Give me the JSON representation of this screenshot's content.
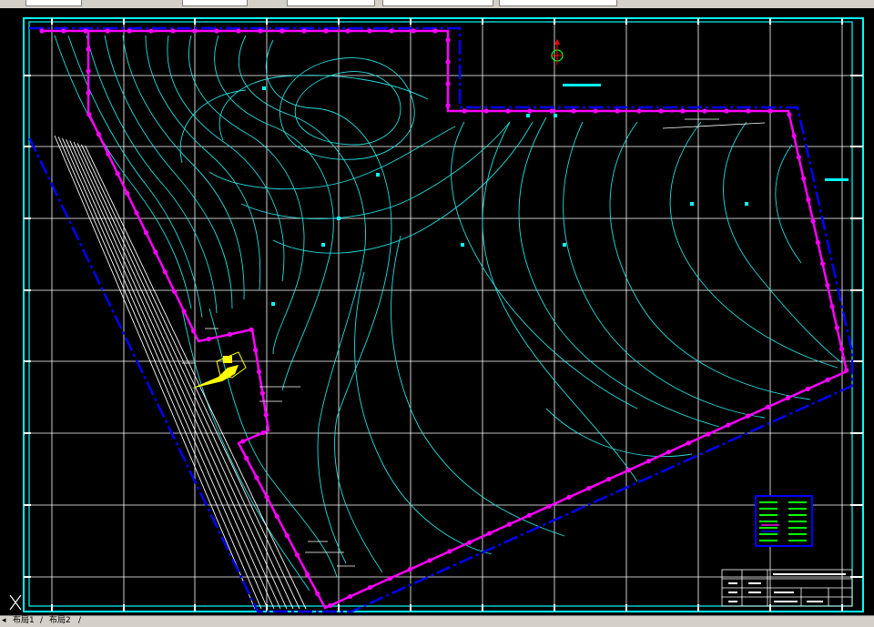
{
  "toolbar": {
    "fields": [
      "",
      "",
      "",
      ""
    ]
  },
  "layout_tabs": {
    "nav_first": "◂",
    "tab_1": "布局1",
    "tab_2": "布局2",
    "separator": "/"
  },
  "colors": {
    "background": "#000000",
    "frame": "#00ffff",
    "grid": "#ffffff",
    "contour": "#22dddd",
    "boundary": "#ff00ff",
    "offset_boundary": "#0000ff",
    "road": "#ffffff",
    "highlight": "#ffff00",
    "legend_text": "#00ff00"
  },
  "icons": {
    "north_arrow": "north-arrow-icon",
    "ucs": "ucs-x-icon"
  }
}
